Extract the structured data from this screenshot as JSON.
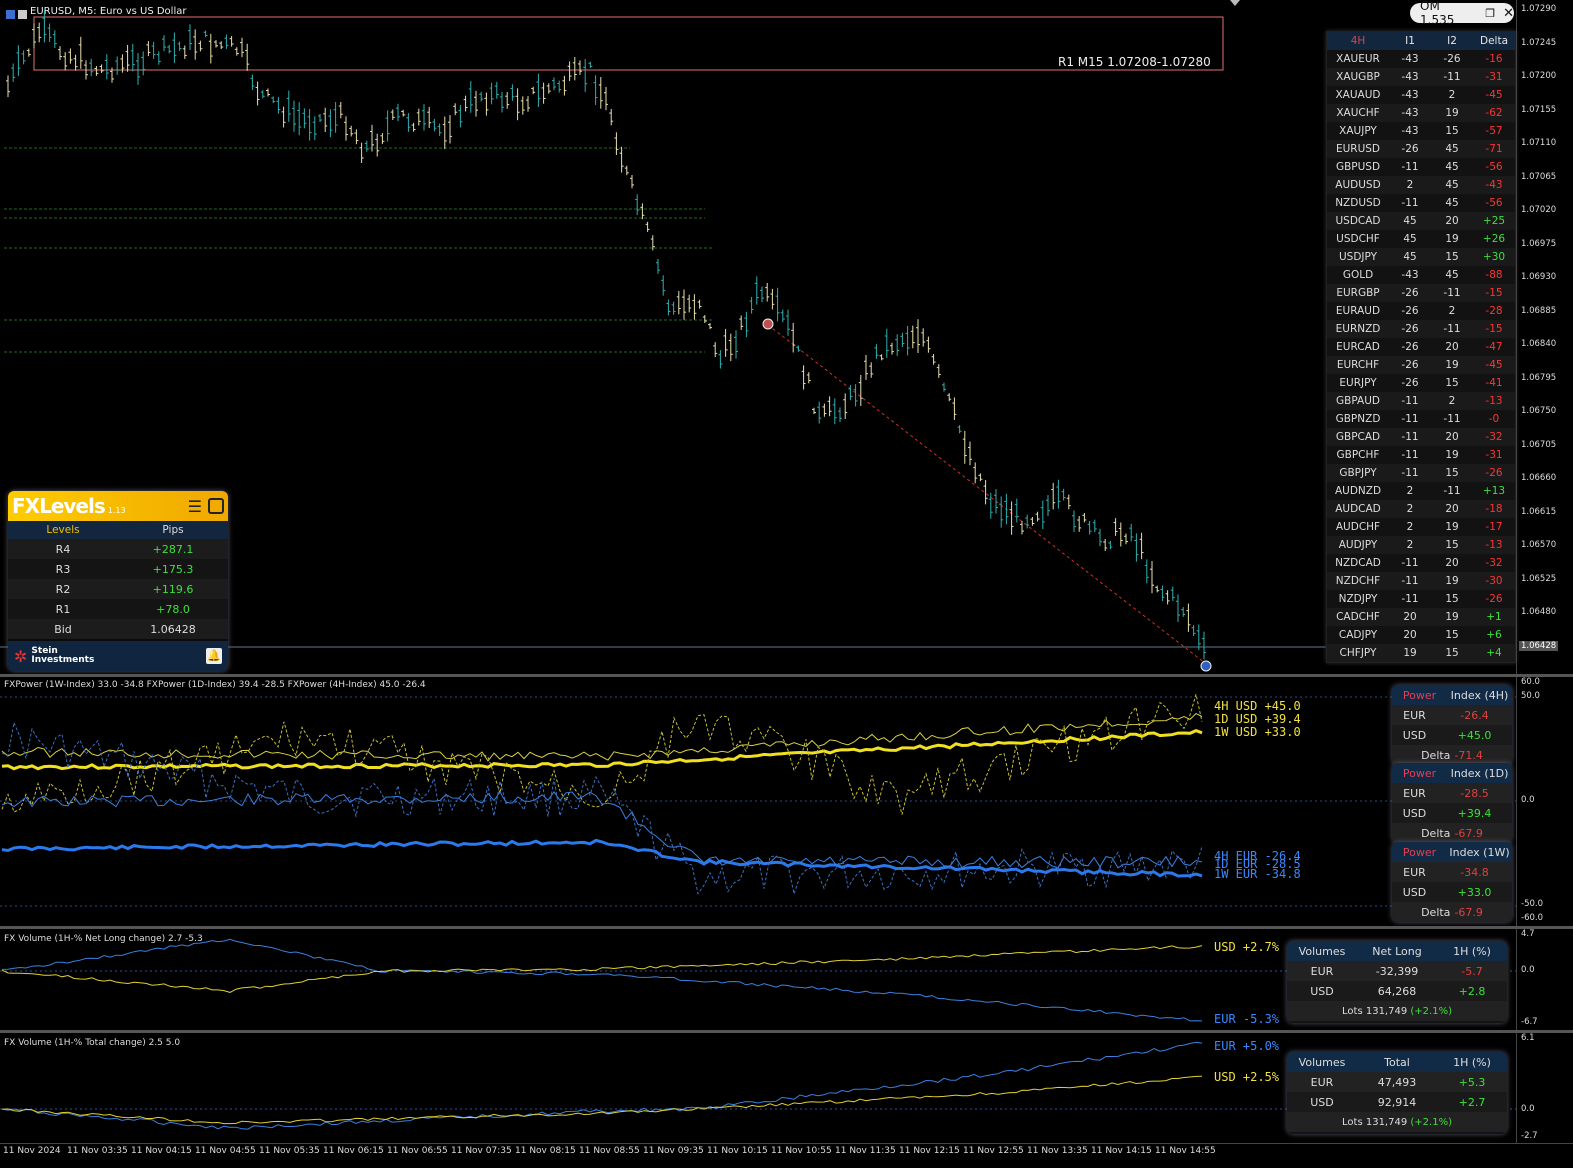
{
  "title": "EURUSD, M5: Euro vs US Dollar",
  "om_label": "OM 1.535",
  "r1_label": "R1 M15 1.07208-1.07280",
  "price_axis": [
    "1.07290",
    "1.07245",
    "1.07200",
    "1.07155",
    "1.07110",
    "1.07065",
    "1.07020",
    "1.06975",
    "1.06930",
    "1.06885",
    "1.06840",
    "1.06795",
    "1.06750",
    "1.06705",
    "1.06660",
    "1.06615",
    "1.06570",
    "1.06525",
    "1.06480",
    "1.06435"
  ],
  "bid_tag": "1.06428",
  "corr_table": {
    "headers": [
      "4H",
      "I1",
      "I2",
      "Delta"
    ],
    "rows": [
      [
        "XAUEUR",
        "-43",
        "-26",
        "-16"
      ],
      [
        "XAUGBP",
        "-43",
        "-11",
        "-31"
      ],
      [
        "XAUAUD",
        "-43",
        "2",
        "-45"
      ],
      [
        "XAUCHF",
        "-43",
        "19",
        "-62"
      ],
      [
        "XAUJPY",
        "-43",
        "15",
        "-57"
      ],
      [
        "EURUSD",
        "-26",
        "45",
        "-71"
      ],
      [
        "GBPUSD",
        "-11",
        "45",
        "-56"
      ],
      [
        "AUDUSD",
        "2",
        "45",
        "-43"
      ],
      [
        "NZDUSD",
        "-11",
        "45",
        "-56"
      ],
      [
        "USDCAD",
        "45",
        "20",
        "+25"
      ],
      [
        "USDCHF",
        "45",
        "19",
        "+26"
      ],
      [
        "USDJPY",
        "45",
        "15",
        "+30"
      ],
      [
        "GOLD",
        "-43",
        "45",
        "-88"
      ],
      [
        "EURGBP",
        "-26",
        "-11",
        "-15"
      ],
      [
        "EURAUD",
        "-26",
        "2",
        "-28"
      ],
      [
        "EURNZD",
        "-26",
        "-11",
        "-15"
      ],
      [
        "EURCAD",
        "-26",
        "20",
        "-47"
      ],
      [
        "EURCHF",
        "-26",
        "19",
        "-45"
      ],
      [
        "EURJPY",
        "-26",
        "15",
        "-41"
      ],
      [
        "GBPAUD",
        "-11",
        "2",
        "-13"
      ],
      [
        "GBPNZD",
        "-11",
        "-11",
        "-0"
      ],
      [
        "GBPCAD",
        "-11",
        "20",
        "-32"
      ],
      [
        "GBPCHF",
        "-11",
        "19",
        "-31"
      ],
      [
        "GBPJPY",
        "-11",
        "15",
        "-26"
      ],
      [
        "AUDNZD",
        "2",
        "-11",
        "+13"
      ],
      [
        "AUDCAD",
        "2",
        "20",
        "-18"
      ],
      [
        "AUDCHF",
        "2",
        "19",
        "-17"
      ],
      [
        "AUDJPY",
        "2",
        "15",
        "-13"
      ],
      [
        "NZDCAD",
        "-11",
        "20",
        "-32"
      ],
      [
        "NZDCHF",
        "-11",
        "19",
        "-30"
      ],
      [
        "NZDJPY",
        "-11",
        "15",
        "-26"
      ],
      [
        "CADCHF",
        "20",
        "19",
        "+1"
      ],
      [
        "CADJPY",
        "20",
        "15",
        "+6"
      ],
      [
        "CHFJPY",
        "19",
        "15",
        "+4"
      ]
    ]
  },
  "fxlevels": {
    "brand": "FXLevels",
    "version": "1.13",
    "col_levels": "Levels",
    "col_pips": "Pips",
    "rows": [
      [
        "R4",
        "+287.1"
      ],
      [
        "R3",
        "+175.3"
      ],
      [
        "R2",
        "+119.6"
      ],
      [
        "R1",
        "+78.0"
      ],
      [
        "Bid",
        "1.06428"
      ]
    ],
    "footer_brand": "Stein Investments"
  },
  "fxpower": {
    "label": "FXPower (1W-Index) 33.0 -34.8 FXPower (1D-Index) 39.4 -28.5 FXPower (4H-Index) 45.0 -26.4",
    "axis": [
      "60.0",
      "50.0",
      "0.0",
      "-50.0",
      "-60.0"
    ],
    "legend_usd": [
      "4H USD +45.0",
      "1D USD +39.4",
      "1W USD +33.0"
    ],
    "legend_eur": [
      "4H EUR -26.4",
      "1D EUR -28.5",
      "1W EUR -34.8"
    ],
    "panels": [
      {
        "h1": "Power",
        "h2": "Index (4H)",
        "eur": "-26.4",
        "usd": "+45.0",
        "delta_label": "Delta",
        "delta": "-71.4"
      },
      {
        "h1": "Power",
        "h2": "Index (1D)",
        "eur": "-28.5",
        "usd": "+39.4",
        "delta_label": "Delta",
        "delta": "-67.9"
      },
      {
        "h1": "Power",
        "h2": "Index (1W)",
        "eur": "-34.8",
        "usd": "+33.0",
        "delta_label": "Delta",
        "delta": "-67.9"
      }
    ],
    "eur_label": "EUR",
    "usd_label": "USD"
  },
  "vol_net": {
    "label": "FX Volume (1H-% Net Long change)  2.7 -5.3",
    "axis": [
      "4.7",
      "0.0",
      "-6.7"
    ],
    "legend_usd": "USD +2.7%",
    "legend_eur": "EUR -5.3%",
    "headers": [
      "Volumes",
      "Net Long",
      "1H (%)"
    ],
    "rows": [
      [
        "EUR",
        "-32,399",
        "-5.7"
      ],
      [
        "USD",
        "64,268",
        "+2.8"
      ]
    ],
    "lots": "Lots 131,749",
    "lots_pct": "(+2.1%)"
  },
  "vol_total": {
    "label": "FX Volume (1H-% Total change)  2.5 5.0",
    "axis": [
      "6.1",
      "0.0",
      "-2.7"
    ],
    "legend_eur": "EUR +5.0%",
    "legend_usd": "USD +2.5%",
    "headers": [
      "Volumes",
      "Total",
      "1H (%)"
    ],
    "rows": [
      [
        "EUR",
        "47,493",
        "+5.3"
      ],
      [
        "USD",
        "92,914",
        "+2.7"
      ]
    ],
    "lots": "Lots 131,749",
    "lots_pct": "(+2.1%)"
  },
  "time_axis": [
    "11 Nov 2024",
    "11 Nov 03:35",
    "11 Nov 04:15",
    "11 Nov 04:55",
    "11 Nov 05:35",
    "11 Nov 06:15",
    "11 Nov 06:55",
    "11 Nov 07:35",
    "11 Nov 08:15",
    "11 Nov 08:55",
    "11 Nov 09:35",
    "11 Nov 10:15",
    "11 Nov 10:55",
    "11 Nov 11:35",
    "11 Nov 12:15",
    "11 Nov 12:55",
    "11 Nov 13:35",
    "11 Nov 14:15",
    "11 Nov 14:55"
  ]
}
